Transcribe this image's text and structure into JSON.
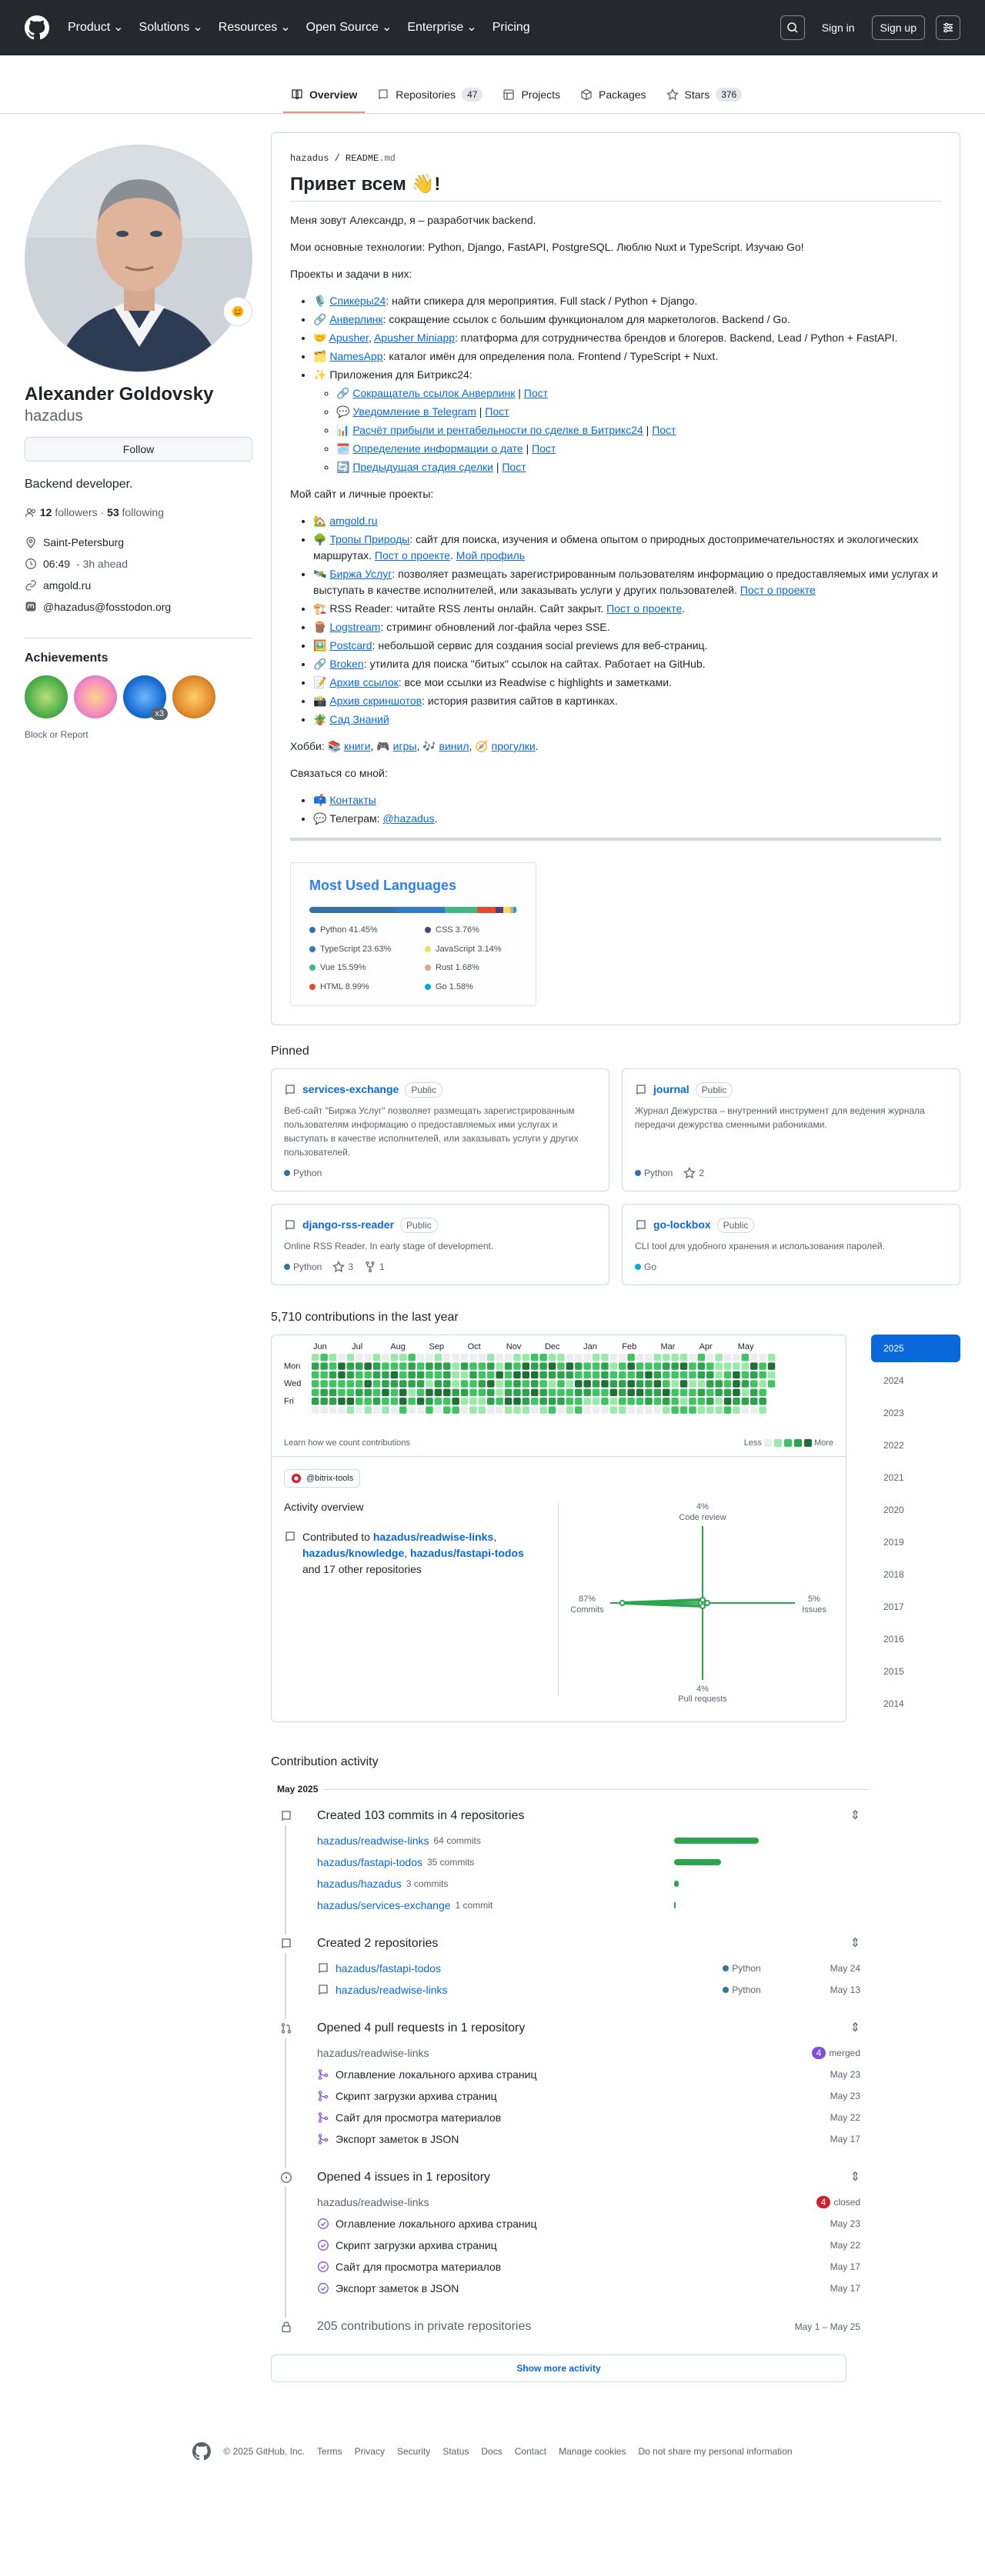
{
  "header": {
    "nav": [
      "Product",
      "Solutions",
      "Resources",
      "Open Source",
      "Enterprise",
      "Pricing"
    ],
    "signin": "Sign in",
    "signup": "Sign up"
  },
  "tabs": [
    {
      "label": "Overview"
    },
    {
      "label": "Repositories",
      "count": "47"
    },
    {
      "label": "Projects"
    },
    {
      "label": "Packages"
    },
    {
      "label": "Stars",
      "count": "376"
    }
  ],
  "profile": {
    "name": "Alexander Goldovsky",
    "login": "hazadus",
    "follow": "Follow",
    "bio": "Backend developer.",
    "followers": "12",
    "followers_label": "followers",
    "following": "53",
    "following_label": "following",
    "location": "Saint-Petersburg",
    "time": "06:49",
    "time_note": "- 3h ahead",
    "website": "amgold.ru",
    "mastodon": "@hazadus@fosstodon.org",
    "achievements_title": "Achievements",
    "achievement_x": "x3",
    "block": "Block or Report"
  },
  "readme": {
    "path_user": "hazadus",
    "path_sep": " / ",
    "path_file": "README",
    "path_ext": ".md",
    "title": "Привет всем 👋!",
    "p1": "Меня зовут Александр, я – разработчик backend.",
    "p2": "Мои основные технологии: Python, Django, FastAPI, PostgreSQL. Люблю Nuxt и TypeScript. Изучаю Go!",
    "p3": "Проекты и задачи в них:",
    "projects": [
      {
        "emoji": "🎙️",
        "name": "Спикеры24",
        "text": ": найти спикера для мероприятия. Full stack / Python + Django."
      },
      {
        "emoji": "🔗",
        "name": "Анверлинк",
        "text": ": сокращение ссылок с большим функционалом для маркетологов. Backend / Go."
      },
      {
        "emoji": "🤝",
        "name": "Apusher",
        "sep": ", ",
        "name2": "Apusher Miniapp",
        "text": ": платформа для сотрудничества брендов и блогеров. Backend, Lead / Python + FastAPI."
      },
      {
        "emoji": "🗂️",
        "name": "NamesApp",
        "text": ": каталог имён для определения пола. Frontend / TypeScript + Nuxt."
      }
    ],
    "bitrix_title": "Приложения для Битрикс24:",
    "bitrix": [
      {
        "emoji": "🔗",
        "name": "Сокращатель ссылок Анверлинк",
        "post": "Пост"
      },
      {
        "emoji": "💬",
        "name": "Уведомление в Telegram",
        "post": "Пост"
      },
      {
        "emoji": "📊",
        "name": "Расчёт прибыли и рентабельности по сделке в Битрикс24",
        "post": "Пост"
      },
      {
        "emoji": "🗓️",
        "name": "Определение информации о дате",
        "post": "Пост"
      },
      {
        "emoji": "🔄",
        "name": "Предыдущая стадия сделки",
        "post": "Пост"
      }
    ],
    "p4": "Мой сайт и личные проекты:",
    "site": {
      "emoji": "🏡",
      "name": "amgold.ru"
    },
    "tropy": {
      "emoji": "🌳",
      "name": "Тропы Природы",
      "text": ": сайт для поиска, изучения и обмена опытом о природных достопримечательностях и экологических маршрутах.",
      "l1": "Пост о проекте",
      "l2": "Мой профиль"
    },
    "birzha": {
      "emoji": "🛰️",
      "name": "Биржа Услуг",
      "text": ": позволяет размещать зарегистрированным пользователям информацию о предоставляемых ими услугах и выступать в качестве исполнителей, или заказывать услуги у других пользователей.",
      "l1": "Пост о проекте"
    },
    "rss": {
      "emoji": "🏗️",
      "text": "RSS Reader: читайте RSS ленты онлайн. Сайт закрыт.",
      "l1": "Пост о проекте"
    },
    "others": [
      {
        "emoji": "🪵",
        "name": "Logstream",
        "text": ": стриминг обновлений лог-файла через SSE."
      },
      {
        "emoji": "🖼️",
        "name": "Postcard",
        "text": ": небольшой сервис для создания social previews для веб-страниц."
      },
      {
        "emoji": "🔗",
        "name": "Broken",
        "text": ": утилита для поиска \"битых\" ссылок на сайтах. Работает на GitHub."
      },
      {
        "emoji": "📝",
        "name": "Архив ссылок",
        "text": ": все мои ссылки из Readwise с highlights и заметками."
      },
      {
        "emoji": "📸",
        "name": "Архив скриншотов",
        "text": ": история развития сайтов в картинках."
      },
      {
        "emoji": "🪴",
        "name": "Сад Знаний",
        "text": ""
      }
    ],
    "hobby_label": "Хобби: 📚 ",
    "hobby": [
      "книги",
      "игры",
      "винил",
      "прогулки"
    ],
    "hobby_emoji": [
      "🎮 ",
      "🎶 ",
      "🧭 "
    ],
    "contact_label": "Связаться со мной:",
    "contacts_link": "Контакты",
    "telegram_label": "Телеграм: ",
    "telegram": "@hazadus"
  },
  "most_used": {
    "title": "Most Used Languages",
    "langs": [
      {
        "name": "Python",
        "pct": "41.45%",
        "value": 41.45,
        "color": "#3572A5"
      },
      {
        "name": "CSS",
        "pct": "3.76%",
        "value": 3.76,
        "color": "#563d7c"
      },
      {
        "name": "TypeScript",
        "pct": "23.63%",
        "value": 23.63,
        "color": "#3178c6"
      },
      {
        "name": "JavaScript",
        "pct": "3.14%",
        "value": 3.14,
        "color": "#f1e05a"
      },
      {
        "name": "Vue",
        "pct": "15.59%",
        "value": 15.59,
        "color": "#41b883"
      },
      {
        "name": "Rust",
        "pct": "1.68%",
        "value": 1.68,
        "color": "#dea584"
      },
      {
        "name": "HTML",
        "pct": "8.99%",
        "value": 8.99,
        "color": "#e34c26"
      },
      {
        "name": "Go",
        "pct": "1.58%",
        "value": 1.58,
        "color": "#00ADD8"
      }
    ]
  },
  "pinned": {
    "title": "Pinned",
    "items": [
      {
        "name": "services-exchange",
        "vis": "Public",
        "desc": "Веб-сайт \"Биржа Услуг\" позволяет размещать зарегистрированным пользователям информацию о предоставляемых ими услугах и выступать в качестве исполнителей, или заказывать услуги у других пользователей.",
        "lang": "Python",
        "color": "#3572A5"
      },
      {
        "name": "journal",
        "vis": "Public",
        "desc": "Журнал Дежурства – внутренний инструмент для ведения журнала передачи дежурства сменными рабониками.",
        "lang": "Python",
        "color": "#3572A5",
        "stars": "2"
      },
      {
        "name": "django-rss-reader",
        "vis": "Public",
        "desc": "Online RSS Reader. In early stage of development.",
        "lang": "Python",
        "color": "#3572A5",
        "stars": "3",
        "forks": "1"
      },
      {
        "name": "go-lockbox",
        "vis": "Public",
        "desc": "CLI tool для удобного хранения и использования паролей.",
        "lang": "Go",
        "color": "#00ADD8"
      }
    ]
  },
  "contributions": {
    "title": "5,710 contributions in the last year",
    "months": [
      "Jun",
      "Jul",
      "Aug",
      "Sep",
      "Oct",
      "Nov",
      "Dec",
      "Jan",
      "Feb",
      "Mar",
      "Apr",
      "May"
    ],
    "days": [
      "Mon",
      "Wed",
      "Fri"
    ],
    "learn": "Learn how we count contributions",
    "less": "Less",
    "more": "More",
    "org": "@bitrix-tools",
    "activity_title": "Activity overview",
    "contributed_prefix": "Contributed to ",
    "repos": [
      "hazadus/readwise-links",
      "hazadus/knowledge",
      "hazadus/fastapi-todos"
    ],
    "other": "and 17 other repositories",
    "radar": {
      "code_review": {
        "pct": "4%",
        "label": "Code review",
        "value": 4
      },
      "commits": {
        "pct": "87%",
        "label": "Commits",
        "value": 87
      },
      "issues": {
        "pct": "5%",
        "label": "Issues",
        "value": 5
      },
      "pull_requests": {
        "pct": "4%",
        "label": "Pull requests",
        "value": 4
      }
    },
    "years": [
      "2025",
      "2024",
      "2023",
      "2022",
      "2021",
      "2020",
      "2019",
      "2018",
      "2017",
      "2016",
      "2015",
      "2014"
    ]
  },
  "activity": {
    "title": "Contribution activity",
    "month": "May 2025",
    "commits": {
      "title": "Created 103 commits in 4 repositories",
      "items": [
        {
          "repo": "hazadus/readwise-links",
          "count": "64 commits",
          "frac": 1.0
        },
        {
          "repo": "hazadus/fastapi-todos",
          "count": "35 commits",
          "frac": 0.55
        },
        {
          "repo": "hazadus/hazadus",
          "count": "3 commits",
          "frac": 0.05
        },
        {
          "repo": "hazadus/services-exchange",
          "count": "1 commit",
          "frac": 0.02
        }
      ]
    },
    "repos": {
      "title": "Created 2 repositories",
      "items": [
        {
          "repo": "hazadus/fastapi-todos",
          "lang": "Python",
          "date": "May 24"
        },
        {
          "repo": "hazadus/readwise-links",
          "lang": "Python",
          "date": "May 13"
        }
      ]
    },
    "prs": {
      "title": "Opened 4 pull requests in 1 repository",
      "repo": "hazadus/readwise-links",
      "badge_n": "4",
      "badge": "merged",
      "items": [
        {
          "title": "Оглавление локального архива страниц",
          "date": "May 23"
        },
        {
          "title": "Скрипт загрузки архива страниц",
          "date": "May 23"
        },
        {
          "title": "Сайт для просмотра материалов",
          "date": "May 22"
        },
        {
          "title": "Экспорт заметок в JSON",
          "date": "May 17"
        }
      ]
    },
    "issues": {
      "title": "Opened 4 issues in 1 repository",
      "repo": "hazadus/readwise-links",
      "badge_n": "4",
      "badge": "closed",
      "items": [
        {
          "title": "Оглавление локального архива страниц",
          "date": "May 23"
        },
        {
          "title": "Скрипт загрузки архива страниц",
          "date": "May 22"
        },
        {
          "title": "Сайт для просмотра материалов",
          "date": "May 17"
        },
        {
          "title": "Экспорт заметок в JSON",
          "date": "May 17"
        }
      ]
    },
    "private": {
      "title": "205 contributions in private repositories",
      "date": "May 1 – May 25"
    },
    "show_more": "Show more activity"
  },
  "footer": [
    "© 2025 GitHub, Inc.",
    "Terms",
    "Privacy",
    "Security",
    "Status",
    "Docs",
    "Contact",
    "Manage cookies",
    "Do not share my personal information"
  ],
  "colors": {
    "accent": "#0969da",
    "header_bg": "#25292e",
    "tab_underline": "#fd8c73",
    "green": "#2da44e",
    "merged": "#8250df",
    "closed": "#cf222e"
  }
}
